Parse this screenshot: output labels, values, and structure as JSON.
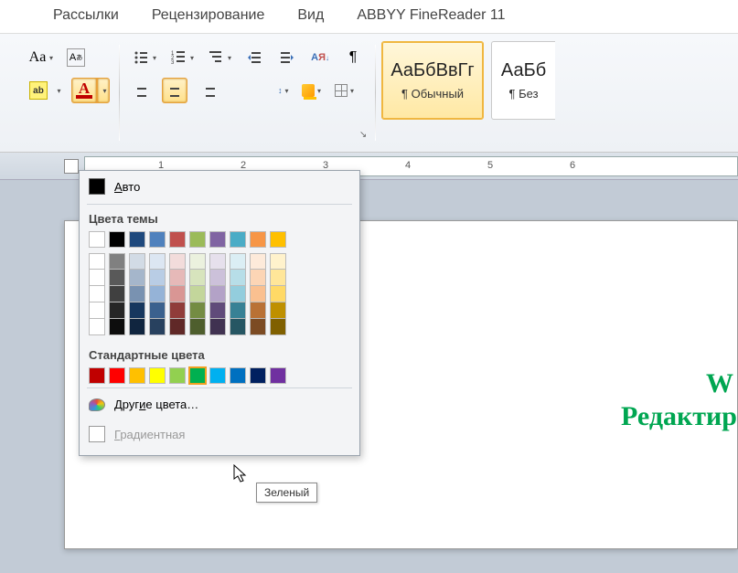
{
  "tabs": {
    "t0": "Рассылки",
    "t1": "Рецензирование",
    "t2": "Вид",
    "t3": "ABBYY FineReader 11"
  },
  "styles": {
    "preview": "АаБбВвГг",
    "s0": "¶ Обычный",
    "s1": "¶ Без"
  },
  "picker": {
    "auto": "Авто",
    "theme_header": "Цвета темы",
    "standard_header": "Стандартные цвета",
    "more": "Другие цвета…",
    "gradient": "Градиентная",
    "tooltip": "Зеленый",
    "theme_base": [
      "#ffffff",
      "#000000",
      "#1f497d",
      "#4f81bd",
      "#c0504d",
      "#9bbb59",
      "#8064a2",
      "#4bacc6",
      "#f79646",
      "#ffc000"
    ],
    "standard": [
      "#c00000",
      "#ff0000",
      "#ffc000",
      "#ffff00",
      "#92d050",
      "#00b050",
      "#00b0f0",
      "#0070c0",
      "#002060",
      "#7030a0"
    ]
  },
  "ruler": {
    "n1": "1",
    "n2": "2",
    "n3": "3",
    "n4": "4",
    "n5": "5",
    "n6": "6"
  },
  "doc": {
    "line1": "W",
    "line2": "Редактир"
  }
}
